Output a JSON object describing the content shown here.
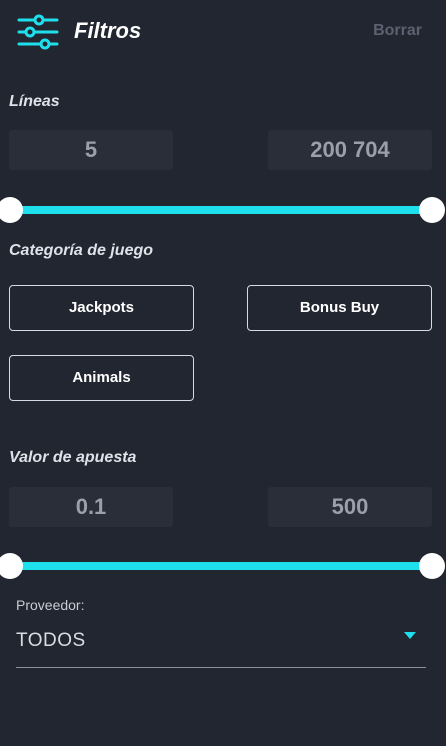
{
  "header": {
    "title": "Filtros",
    "clear_label": "Borrar",
    "icon": "sliders-icon"
  },
  "lines": {
    "label": "Líneas",
    "min_value": "5",
    "max_value": "200 704",
    "range_selected": [
      0,
      1
    ]
  },
  "category": {
    "label": "Categoría de juego",
    "chips": [
      {
        "label": "Jackpots"
      },
      {
        "label": "Bonus Buy"
      },
      {
        "label": "Animals"
      }
    ]
  },
  "bet": {
    "label": "Valor de apuesta",
    "min_value": "0.1",
    "max_value": "500",
    "range_selected": [
      0,
      1
    ]
  },
  "provider": {
    "label": "Proveedor:",
    "selected": "TODOS"
  },
  "colors": {
    "accent": "#1ee0ec",
    "background": "#222630",
    "box": "#2a2e39"
  }
}
